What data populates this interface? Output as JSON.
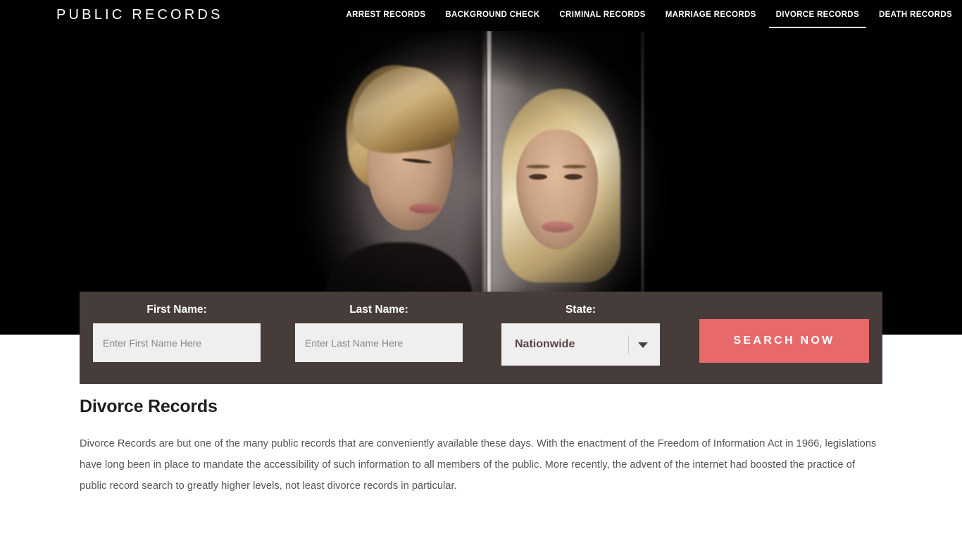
{
  "header": {
    "logo": "PUBLIC RECORDS",
    "nav": [
      {
        "label": "ARREST RECORDS",
        "active": false
      },
      {
        "label": "BACKGROUND CHECK",
        "active": false
      },
      {
        "label": "CRIMINAL RECORDS",
        "active": false
      },
      {
        "label": "MARRIAGE RECORDS",
        "active": false
      },
      {
        "label": "DIVORCE RECORDS",
        "active": true
      },
      {
        "label": "DEATH RECORDS",
        "active": false
      }
    ]
  },
  "hero": {
    "image_alt": "Couple separated by a wall"
  },
  "search": {
    "first_name_label": "First Name:",
    "first_name_placeholder": "Enter First Name Here",
    "first_name_value": "",
    "last_name_label": "Last Name:",
    "last_name_placeholder": "Enter Last Name Here",
    "last_name_value": "",
    "state_label": "State:",
    "state_selected": "Nationwide",
    "submit_label": "SEARCH NOW",
    "bar_color": "#463D3B",
    "button_color": "#E8696A",
    "input_background": "#EFEFEF"
  },
  "main": {
    "title": "Divorce Records",
    "paragraphs": [
      "Divorce Records are but one of the many public records that are conveniently available these days. With the enactment of the Freedom of Information Act in 1966, legislations have long been in place to mandate the accessibility of such information to all members of the public. More recently, the advent of the internet had boosted the practice of public record search to greatly higher levels, not least divorce records in particular."
    ]
  }
}
